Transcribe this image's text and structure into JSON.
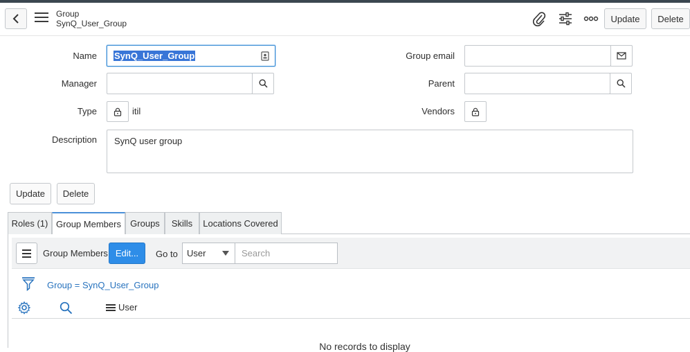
{
  "header": {
    "title": "Group",
    "subtitle": "SynQ_User_Group",
    "update_label": "Update",
    "delete_label": "Delete"
  },
  "form": {
    "name_label": "Name",
    "name_value": "SynQ_User_Group",
    "manager_label": "Manager",
    "manager_value": "",
    "type_label": "Type",
    "type_value": "itil",
    "description_label": "Description",
    "description_value": "SynQ user group",
    "group_email_label": "Group email",
    "group_email_value": "",
    "parent_label": "Parent",
    "parent_value": "",
    "vendors_label": "Vendors"
  },
  "actions": {
    "update_label": "Update",
    "delete_label": "Delete"
  },
  "tabs": [
    {
      "label": "Roles (1)",
      "active": false
    },
    {
      "label": "Group Members",
      "active": true
    },
    {
      "label": "Groups",
      "active": false
    },
    {
      "label": "Skills",
      "active": false
    },
    {
      "label": "Locations Covered",
      "active": false
    }
  ],
  "list": {
    "title": "Group Members",
    "edit_label": "Edit...",
    "goto_label": "Go to",
    "goto_selected": "User",
    "search_placeholder": "Search",
    "filter_text": "Group = SynQ_User_Group",
    "column_user": "User",
    "empty_text": "No records to display"
  },
  "colors": {
    "accent": "#2e8de8",
    "link": "#2873be",
    "selection": "#3875d7"
  },
  "icons": [
    "back-icon",
    "menu-icon",
    "paperclip-icon",
    "settings-sliders-icon",
    "more-icon",
    "address-book-icon",
    "envelope-icon",
    "search-icon",
    "lock-icon",
    "filter-icon",
    "gear-icon",
    "hamburger-icon"
  ]
}
